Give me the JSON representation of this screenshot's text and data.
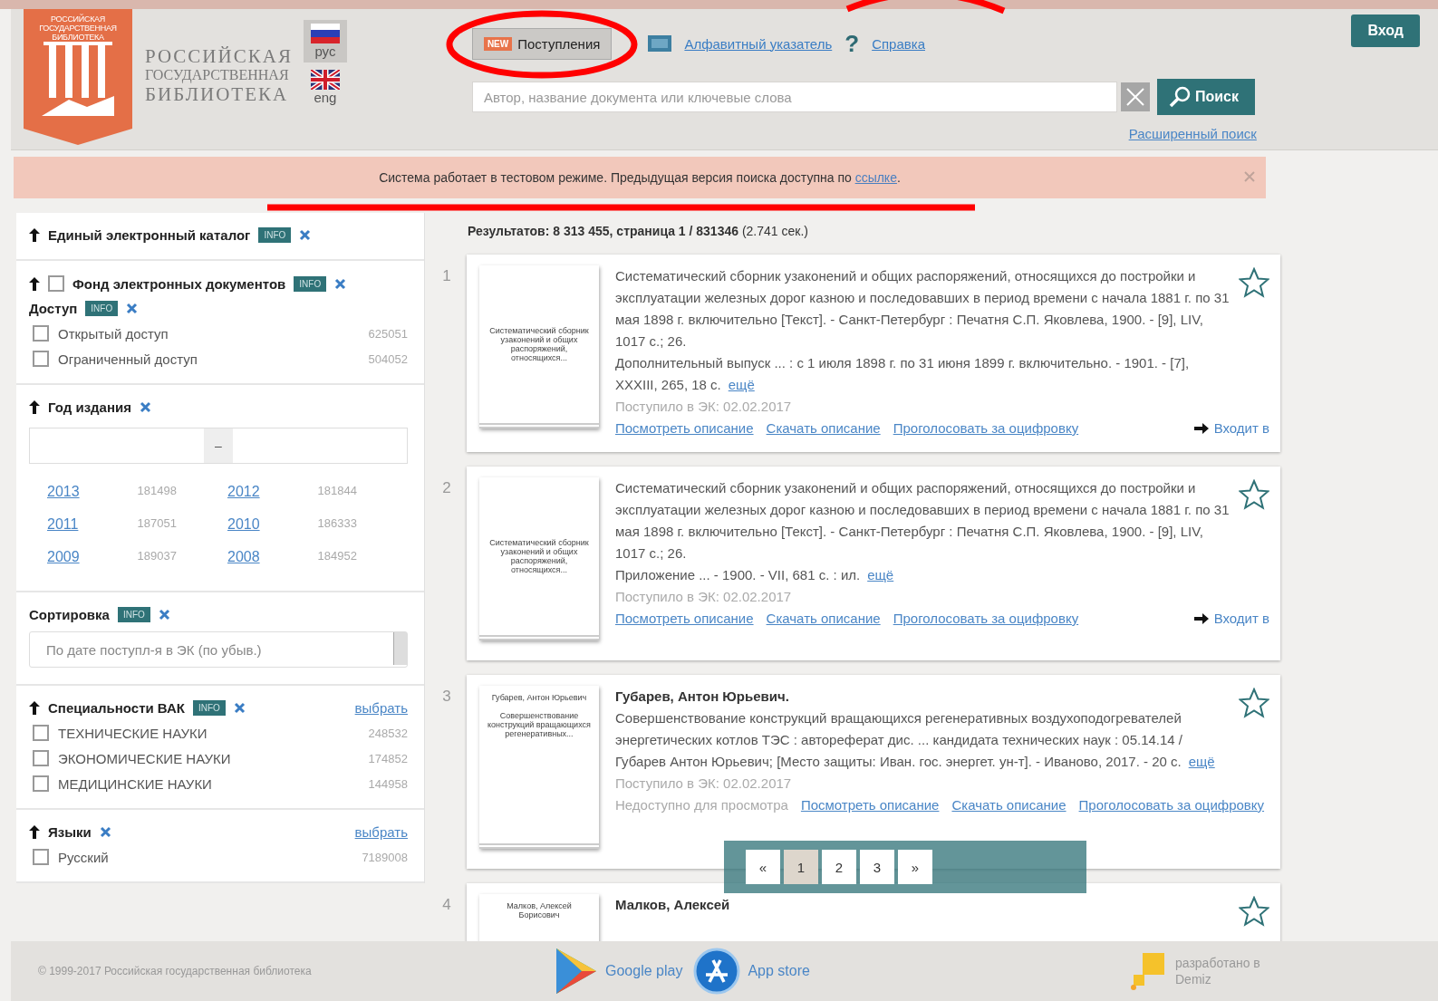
{
  "header": {
    "logo_text": [
      "РОССИЙСКАЯ",
      "ГОСУДАРСТВЕННАЯ",
      "БИБЛИОТЕКА"
    ],
    "library_name": [
      "РОССИЙСКАЯ",
      "ГОСУДАРСТВЕННАЯ",
      "БИБЛИОТЕКА"
    ],
    "languages": [
      {
        "label": "рус",
        "selected": true,
        "kind": "ru"
      },
      {
        "label": "eng",
        "selected": false,
        "kind": "uk"
      }
    ],
    "nav": [
      {
        "kind": "badge",
        "badge": "NEW",
        "label": "Поступления",
        "selected": true
      },
      {
        "kind": "index",
        "label": "Алфавитный указатель",
        "selected": false
      },
      {
        "kind": "help",
        "glyph": "?",
        "label": "Справка",
        "selected": false
      }
    ],
    "search": {
      "placeholder": "Автор, название документа или ключевые слова",
      "button": "Поиск",
      "advanced": "Расширенный поиск"
    },
    "login": "Вход"
  },
  "notice": {
    "text": "Система работает в тестовом режиме. Предыдущая версия поиска доступна по ",
    "link": "ссылке",
    "end": "."
  },
  "sidebar": [
    {
      "kind": "plain",
      "title": "Единый электронный каталог",
      "info": "INFO"
    },
    {
      "kind": "fund",
      "title": "Фонд электронных документов",
      "checked": false,
      "info": "INFO",
      "subtitle": "Доступ",
      "sub_info": "INFO",
      "items": [
        {
          "label": "Открытый доступ",
          "count": "625051",
          "checked": false
        },
        {
          "label": "Ограниченный доступ",
          "count": "504052",
          "checked": false
        }
      ]
    },
    {
      "kind": "years",
      "title": "Год издания",
      "separator": "–",
      "years": [
        {
          "year": "2013",
          "count": "181498"
        },
        {
          "year": "2012",
          "count": "181844"
        },
        {
          "year": "2011",
          "count": "187051"
        },
        {
          "year": "2010",
          "count": "186333"
        },
        {
          "year": "2009",
          "count": "189037"
        },
        {
          "year": "2008",
          "count": "184952"
        }
      ]
    },
    {
      "kind": "sort",
      "title": "Сортировка",
      "info": "INFO",
      "value": "По дате поступл-я в ЭК (по убыв.)"
    },
    {
      "kind": "checklist",
      "title": "Специальности ВАК",
      "info": "INFO",
      "choose": "выбрать",
      "items": [
        {
          "label": "ТЕХНИЧЕСКИЕ НАУКИ",
          "count": "248532",
          "checked": false
        },
        {
          "label": "ЭКОНОМИЧЕСКИЕ НАУКИ",
          "count": "174852",
          "checked": false
        },
        {
          "label": "МЕДИЦИНСКИЕ НАУКИ",
          "count": "144958",
          "checked": false
        }
      ]
    },
    {
      "kind": "checklist",
      "title": "Языки",
      "choose": "выбрать",
      "items": [
        {
          "label": "Русский",
          "count": "7189008",
          "checked": false
        }
      ]
    }
  ],
  "results": {
    "summary": "**Результатов: 8 313 455, страница 1 / 831346** (2.741 сек.)",
    "items": [
      {
        "number": "1",
        "thumb": [
          "Систематический сборник узаконений и общих распоряжений, относящихся..."
        ],
        "description": [
          "Систематический сборник узаконений и общих распоряжений, относящихся до постройки и эксплуатации железных дорог казною и последовавших в период времени с начала 1881 г. по 31 мая 1898 г. включительно [Текст]. - Санкт-Петербург : Печатня С.П. Яковлева, 1900. - [9], LIV, 1017 с.; 26.",
          "Дополнительный выпуск ... : с 1 июля 1898 г. по 31 июня 1899 г. включительно. - 1901. - [7], XXXIII, 265, 18 с."
        ],
        "more": "ещё",
        "received": "Поступило в ЭК: 02.02.2017",
        "links": [
          "Посмотреть описание",
          "Скачать описание",
          "Проголосовать за оцифровку"
        ],
        "part_of": "Входит в"
      },
      {
        "number": "2",
        "thumb": [
          "Систематический сборник узаконений и общих распоряжений, относящихся..."
        ],
        "description": [
          "Систематический сборник узаконений и общих распоряжений, относящихся до постройки и эксплуатации железных дорог казною и последовавших в период времени с начала 1881 г. по 31 мая 1898 г. включительно [Текст]. - Санкт-Петербург : Печатня С.П. Яковлева, 1900. - [9], LIV, 1017 с.; 26.",
          "Приложение ... - 1900. - VII, 681 с. : ил."
        ],
        "more": "ещё",
        "received": "Поступило в ЭК: 02.02.2017",
        "links": [
          "Посмотреть описание",
          "Скачать описание",
          "Проголосовать за оцифровку"
        ],
        "part_of": "Входит в"
      },
      {
        "number": "3",
        "thumb": [
          "Губарев, Антон Юрьевич",
          "Совершенствование конструкций вращающихся регенеративных..."
        ],
        "title": "Губарев, Антон Юрьевич.",
        "description": [
          "Совершенствование конструкций вращающихся регенеративных воздухоподогревателей энергетических котлов ТЭС : автореферат дис. ... кандидата технических наук : 05.14.14 / Губарев Антон Юрьевич; [Место защиты: Иван. гос. энергет. ун-т]. - Иваново, 2017. - 20 с."
        ],
        "more": "ещё",
        "received": "Поступило в ЭК: 02.02.2017",
        "unavailable": "Недоступно для просмотра",
        "links": [
          "Посмотреть описание",
          "Скачать описание",
          "Проголосовать за оцифровку"
        ]
      },
      {
        "number": "4",
        "thumb": [
          "Малков, Алексей Борисович"
        ],
        "title": "Малков, Алексей"
      }
    ]
  },
  "pagination": [
    {
      "label": "«",
      "selected": false
    },
    {
      "label": "1",
      "selected": true
    },
    {
      "label": "2",
      "selected": false
    },
    {
      "label": "3",
      "selected": false
    },
    {
      "label": "»",
      "selected": false
    }
  ],
  "footer": {
    "copyright": "© 1999-2017 Российская государственная библиотека",
    "stores": [
      {
        "kind": "google",
        "label": "Google play"
      },
      {
        "kind": "apple",
        "label": "App store"
      }
    ],
    "developer": "разработано в Demiz"
  }
}
